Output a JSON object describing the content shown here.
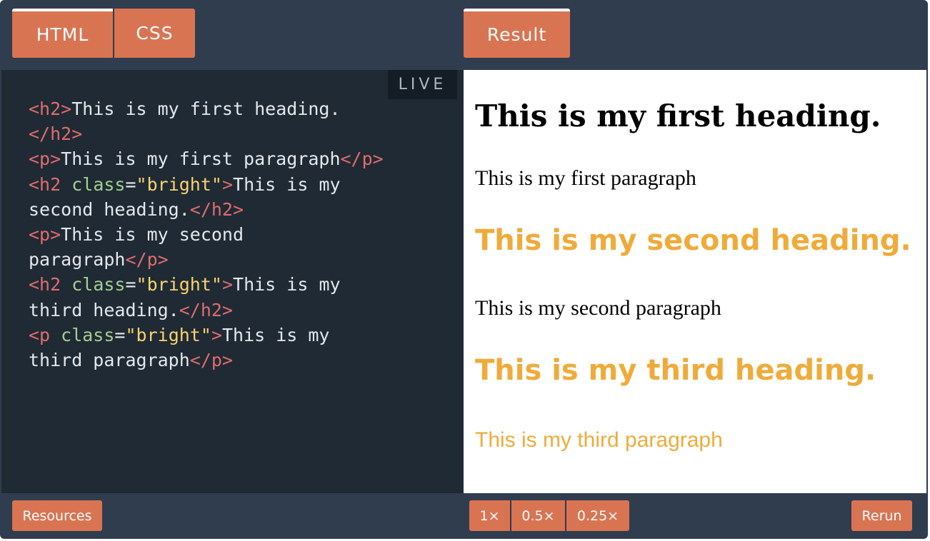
{
  "tabs": {
    "html_label": "HTML",
    "css_label": "CSS",
    "result_label": "Result"
  },
  "editor": {
    "live_label": "LIVE",
    "code_lines": [
      [
        {
          "t": "tg",
          "v": "<h2>"
        },
        {
          "t": "tx",
          "v": "This is my first heading."
        }
      ],
      [
        {
          "t": "tg",
          "v": "</h2>"
        }
      ],
      [
        {
          "t": "tg",
          "v": "<p>"
        },
        {
          "t": "tx",
          "v": "This is my first paragraph"
        },
        {
          "t": "tg",
          "v": "</p>"
        }
      ],
      [
        {
          "t": "tg",
          "v": "<h2 "
        },
        {
          "t": "at",
          "v": "class"
        },
        {
          "t": "tx",
          "v": "="
        },
        {
          "t": "st",
          "v": "\"bright\""
        },
        {
          "t": "tg",
          "v": ">"
        },
        {
          "t": "tx",
          "v": "This is my"
        }
      ],
      [
        {
          "t": "tx",
          "v": "second heading."
        },
        {
          "t": "tg",
          "v": "</h2>"
        }
      ],
      [
        {
          "t": "tg",
          "v": "<p>"
        },
        {
          "t": "tx",
          "v": "This is my second"
        }
      ],
      [
        {
          "t": "tx",
          "v": "paragraph"
        },
        {
          "t": "tg",
          "v": "</p>"
        }
      ],
      [
        {
          "t": "tg",
          "v": "<h2 "
        },
        {
          "t": "at",
          "v": "class"
        },
        {
          "t": "tx",
          "v": "="
        },
        {
          "t": "st",
          "v": "\"bright\""
        },
        {
          "t": "tg",
          "v": ">"
        },
        {
          "t": "tx",
          "v": "This is my"
        }
      ],
      [
        {
          "t": "tx",
          "v": "third heading."
        },
        {
          "t": "tg",
          "v": "</h2>"
        }
      ],
      [
        {
          "t": "tg",
          "v": "<p "
        },
        {
          "t": "at",
          "v": "class"
        },
        {
          "t": "tx",
          "v": "="
        },
        {
          "t": "st",
          "v": "\"bright\""
        },
        {
          "t": "tg",
          "v": ">"
        },
        {
          "t": "tx",
          "v": "This is my"
        }
      ],
      [
        {
          "t": "tx",
          "v": "third paragraph"
        },
        {
          "t": "tg",
          "v": "</p>"
        }
      ]
    ]
  },
  "result": {
    "heading_1": "This is my first heading.",
    "paragraph_1": "This is my first paragraph",
    "heading_2": "This is my second heading.",
    "paragraph_2": "This is my second paragraph",
    "heading_3": "This is my third heading.",
    "paragraph_3": "This is my third paragraph"
  },
  "footer": {
    "resources_label": "Resources",
    "zoom_options": [
      "1×",
      "0.5×",
      "0.25×"
    ],
    "rerun_label": "Rerun"
  },
  "colors": {
    "accent": "#d97453",
    "bright": "#efab3a",
    "chrome": "#303d4f",
    "editor_bg": "#1f2a35"
  }
}
